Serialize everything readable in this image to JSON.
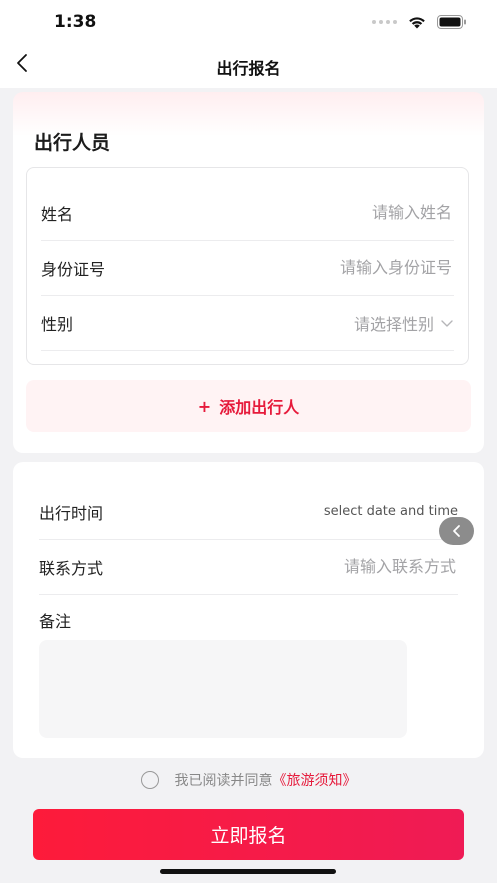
{
  "status_bar": {
    "time": "1:38"
  },
  "nav": {
    "title": "出行报名"
  },
  "travelers": {
    "section_title": "出行人员",
    "fields": [
      {
        "label": "姓名",
        "placeholder": "请输入姓名"
      },
      {
        "label": "身份证号",
        "placeholder": "请输入身份证号"
      },
      {
        "label": "性别",
        "placeholder": "请选择性别"
      }
    ],
    "add_label": "添加出行人"
  },
  "details": {
    "time_label": "出行时间",
    "time_placeholder": "select date and time",
    "contact_label": "联系方式",
    "contact_placeholder": "请输入联系方式",
    "remark_label": "备注"
  },
  "agreement": {
    "text": "我已阅读并同意",
    "link": "《旅游须知》"
  },
  "submit_label": "立即报名",
  "colors": {
    "accent": "#e61a3b",
    "button_start": "#fd1b3a",
    "button_end": "#ef1b55"
  }
}
